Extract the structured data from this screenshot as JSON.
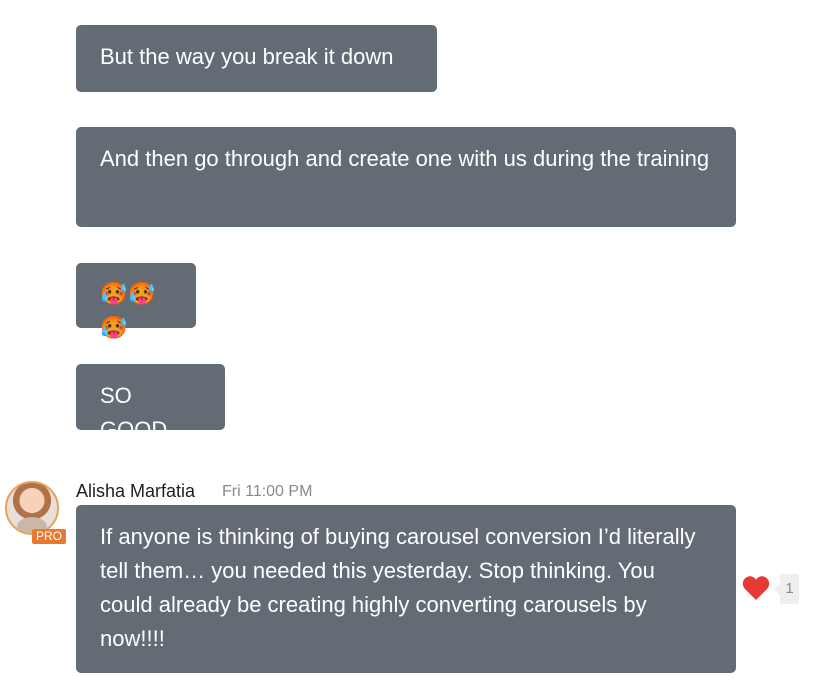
{
  "messages": [
    {
      "text": "But the way you break it down"
    },
    {
      "text": "And then go through and create one with us during the training"
    },
    {
      "text": "🥵🥵🥵"
    },
    {
      "text": "SO GOOD"
    },
    {
      "author": "Alisha Marfatia",
      "timestamp": "Fri 11:00 PM",
      "badge": "PRO",
      "text": "If anyone is thinking of buying carousel conversion I’d literally tell them… you needed this yesterday. Stop thinking. You could already be creating highly converting carousels by now!!!!",
      "reactions": [
        {
          "icon": "heart-icon",
          "count": "1",
          "color": "#e53935"
        }
      ]
    }
  ],
  "colors": {
    "bubble": "#636b74",
    "badge": "#e8792f"
  }
}
